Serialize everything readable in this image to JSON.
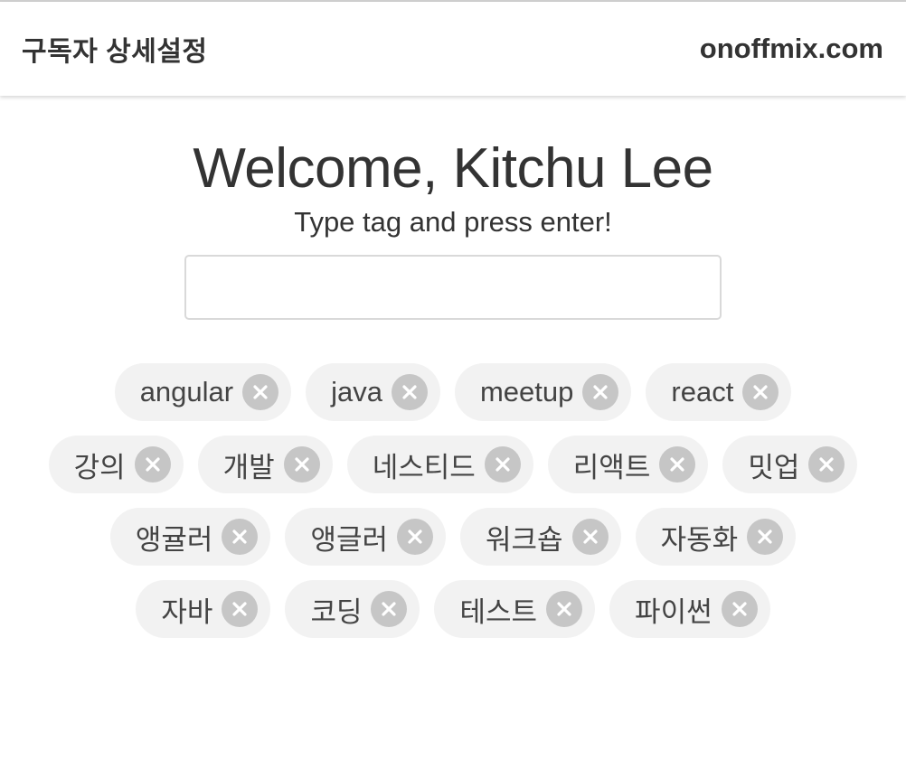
{
  "header": {
    "title": "구독자 상세설정",
    "brand": "onoffmix.com"
  },
  "main": {
    "welcome": "Welcome, Kitchu Lee",
    "instruction": "Type tag and press enter!",
    "input": {
      "value": "",
      "placeholder": ""
    }
  },
  "tags": [
    {
      "label": "angular"
    },
    {
      "label": "java"
    },
    {
      "label": "meetup"
    },
    {
      "label": "react"
    },
    {
      "label": "강의"
    },
    {
      "label": "개발"
    },
    {
      "label": "네스티드"
    },
    {
      "label": "리액트"
    },
    {
      "label": "밋업"
    },
    {
      "label": "앵귤러"
    },
    {
      "label": "앵글러"
    },
    {
      "label": "워크숍"
    },
    {
      "label": "자동화"
    },
    {
      "label": "자바"
    },
    {
      "label": "코딩"
    },
    {
      "label": "테스트"
    },
    {
      "label": "파이썬"
    }
  ],
  "icons": {
    "tag_remove": "close-circle-icon"
  },
  "colors": {
    "text": "#333333",
    "tag_background": "#f2f2f2",
    "tag_remove_background": "#c6c6c6"
  }
}
